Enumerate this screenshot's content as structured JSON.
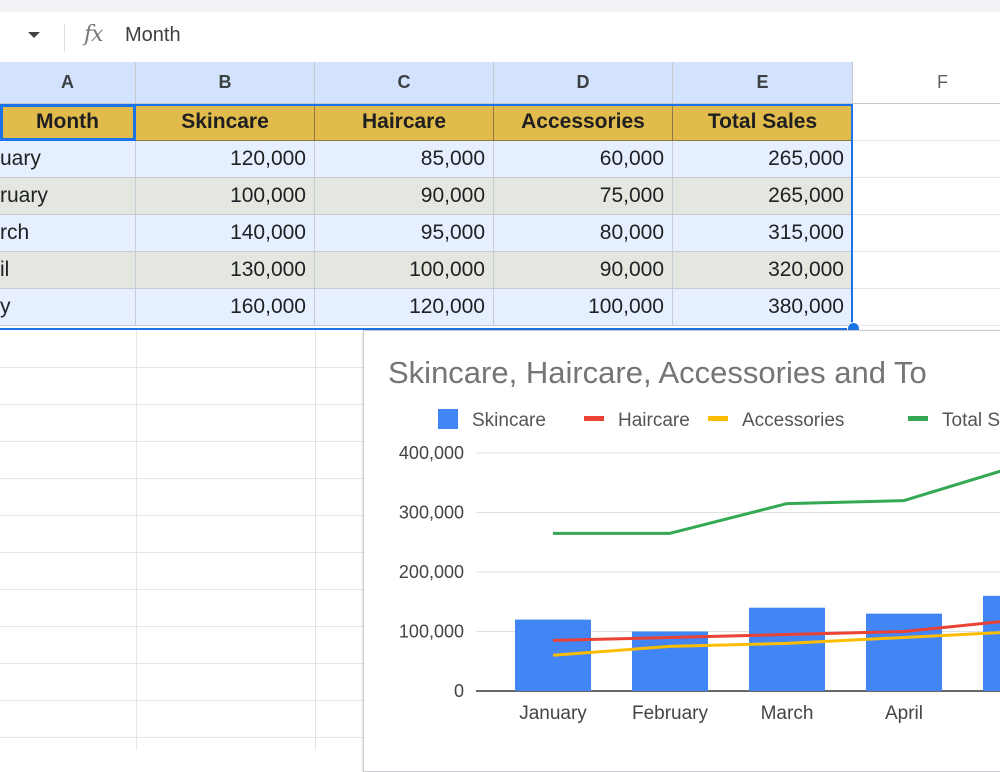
{
  "formula_bar": {
    "fx_symbol": "fx",
    "cell_value": "Month"
  },
  "columns": [
    "A",
    "B",
    "C",
    "D",
    "E",
    "F"
  ],
  "table": {
    "headers": [
      "Month",
      "Skincare",
      "Haircare",
      "Accessories",
      "Total Sales"
    ],
    "rows": [
      [
        "uary",
        "120,000",
        "85,000",
        "60,000",
        "265,000"
      ],
      [
        "ruary",
        "100,000",
        "90,000",
        "75,000",
        "265,000"
      ],
      [
        "rch",
        "140,000",
        "95,000",
        "80,000",
        "315,000"
      ],
      [
        "il",
        "130,000",
        "100,000",
        "90,000",
        "320,000"
      ],
      [
        "y",
        "160,000",
        "120,000",
        "100,000",
        "380,000"
      ]
    ]
  },
  "colors": {
    "skincare": "#4285f4",
    "haircare": "#ea4335",
    "accessories": "#fbbc04",
    "total": "#34a853",
    "header_fill": "#e2bb4d",
    "selection": "#1a73e8"
  },
  "chart_data": {
    "type": "bar",
    "title": "Skincare, Haircare, Accessories and To",
    "legend_position": "top",
    "categories": [
      "January",
      "February",
      "March",
      "April"
    ],
    "series": [
      {
        "name": "Skincare",
        "kind": "bar",
        "values": [
          120000,
          100000,
          140000,
          130000,
          160000
        ]
      },
      {
        "name": "Haircare",
        "kind": "line",
        "values": [
          85000,
          90000,
          95000,
          100000,
          120000
        ]
      },
      {
        "name": "Accessories",
        "kind": "line",
        "values": [
          60000,
          75000,
          80000,
          90000,
          100000
        ]
      },
      {
        "name": "Total S",
        "kind": "line",
        "values": [
          265000,
          265000,
          315000,
          320000,
          380000
        ]
      }
    ],
    "y_ticks": [
      "400,000",
      "300,000",
      "200,000",
      "100,000",
      "0"
    ],
    "ylim": [
      0,
      400000
    ],
    "grid": true
  }
}
